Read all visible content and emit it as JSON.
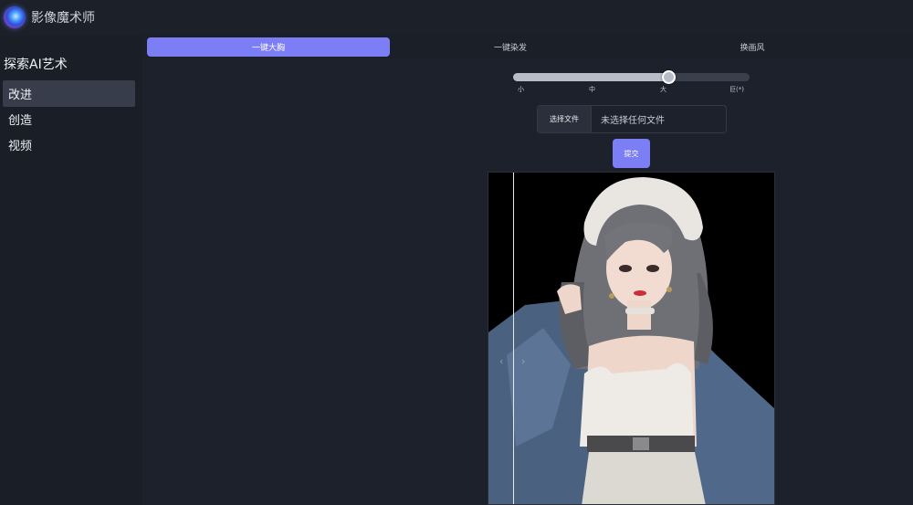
{
  "app": {
    "title": "影像魔术师"
  },
  "sidebar": {
    "heading": "探索AI艺术",
    "items": [
      {
        "label": "改进",
        "active": true
      },
      {
        "label": "创造",
        "active": false
      },
      {
        "label": "视频",
        "active": false
      }
    ]
  },
  "tabs": [
    {
      "label": "一键大胸",
      "active": true
    },
    {
      "label": "一键染发",
      "active": false
    },
    {
      "label": "换画风",
      "active": false
    }
  ],
  "slider": {
    "ticks": [
      "小",
      "中",
      "大",
      "巨(*)"
    ],
    "selected_index": 2
  },
  "file_input": {
    "button_label": "选择文件",
    "status": "未选择任何文件"
  },
  "submit": {
    "label": "提交"
  },
  "compare": {
    "left_arrow": "‹",
    "right_arrow": "›"
  },
  "colors": {
    "accent": "#7b7ef4",
    "background": "#1a1e27",
    "active_nav": "#383d4c"
  }
}
